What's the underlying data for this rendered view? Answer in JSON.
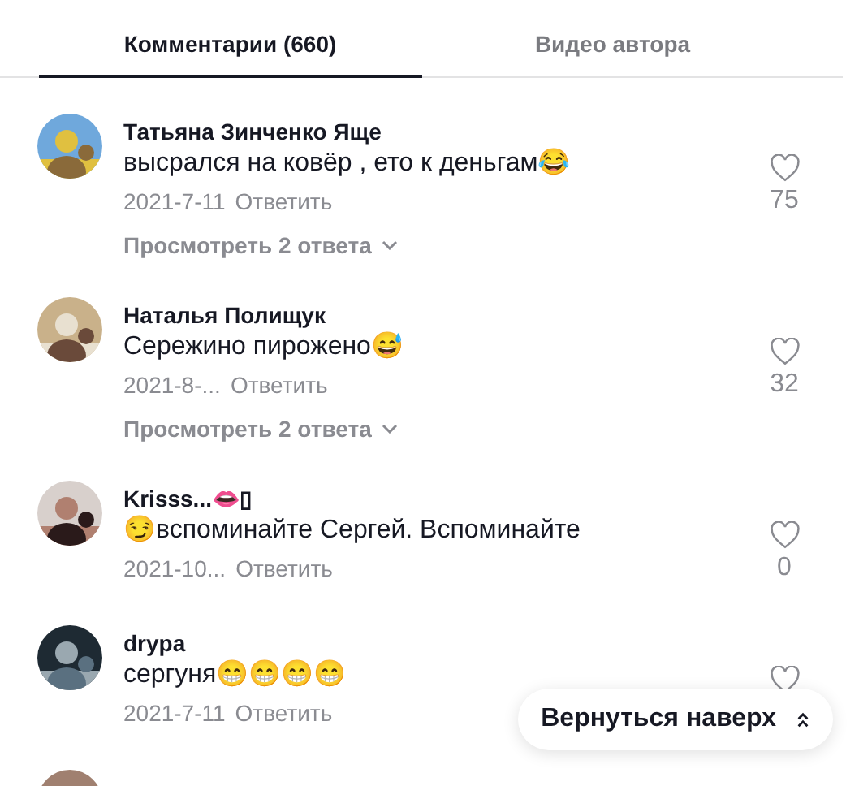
{
  "tabs": [
    {
      "label": "Комментарии (660)",
      "selected": true
    },
    {
      "label": "Видео автора",
      "selected": false
    }
  ],
  "comments": [
    {
      "avatar": {
        "kind": "picture"
      },
      "name": "Татьяна Зинченко Яще",
      "text": "высрался на ковёр , ето к деньгам😂",
      "date": "2021-7-11",
      "reply": "Ответить",
      "likes": "75",
      "replies": "Просмотреть 2 ответа"
    },
    {
      "avatar": {
        "kind": "picture"
      },
      "name": "Наталья Полищук",
      "text": "Сережино пирожено😅",
      "date": "2021-8-...",
      "reply": "Ответить",
      "likes": "32",
      "replies": "Просмотреть 2 ответа"
    },
    {
      "avatar": {
        "kind": "picture"
      },
      "name": "Krisss...👄▯",
      "text": "😏вспоминайте Сергей. Вспоминайте",
      "date": "2021-10...",
      "reply": "Ответить",
      "likes": "0"
    },
    {
      "avatar": {
        "kind": "picture"
      },
      "name": "drypa",
      "text": "сергуня😁😁😁😁",
      "date": "2021-7-11",
      "reply": "Ответить"
    },
    {
      "avatar": {
        "kind": "picture"
      }
    }
  ],
  "back_to_top": {
    "label": "Вернуться наверх"
  }
}
